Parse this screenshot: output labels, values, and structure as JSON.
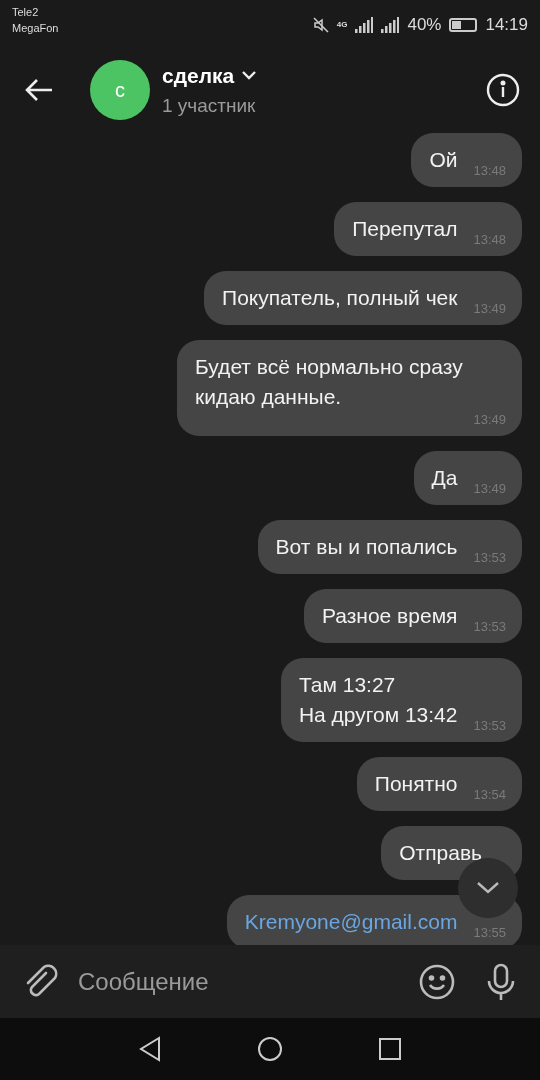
{
  "status_bar": {
    "carriers": [
      "Tele2",
      "MegaFon"
    ],
    "battery_text": "40%",
    "time": "14:19",
    "network": "4G"
  },
  "header": {
    "avatar_letter": "с",
    "title": "сделка",
    "subtitle": "1 участник"
  },
  "messages": [
    {
      "kind": "text",
      "text": "Ой",
      "time": "13:48"
    },
    {
      "kind": "text",
      "text": "Перепутал",
      "time": "13:48"
    },
    {
      "kind": "text",
      "text": "Покупатель, полный чек",
      "time": "13:49"
    },
    {
      "kind": "text",
      "text": "Будет всё нормально сразу кидаю данные.",
      "time": "13:49"
    },
    {
      "kind": "text",
      "text": "Да",
      "time": "13:49"
    },
    {
      "kind": "text",
      "text": "Вот вы и попались",
      "time": "13:53"
    },
    {
      "kind": "text",
      "text": "Разное время",
      "time": "13:53"
    },
    {
      "kind": "text",
      "text": "Там 13:27\nНа другом 13:42",
      "time": "13:53"
    },
    {
      "kind": "text",
      "text": "Понятно",
      "time": "13:54"
    },
    {
      "kind": "text",
      "text": "Отправь"
    },
    {
      "kind": "link",
      "text": "Kremyone@gmail.com",
      "time": "13:55"
    }
  ],
  "composer": {
    "placeholder": "Сообщение"
  }
}
